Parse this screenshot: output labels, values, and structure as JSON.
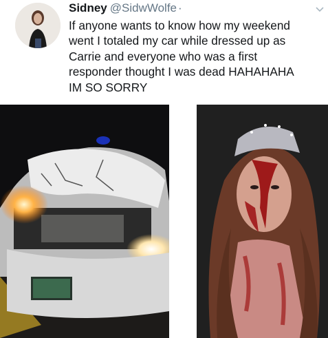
{
  "tweet": {
    "display_name": "Sidney",
    "handle": "@SidwWolfe",
    "separator": "·",
    "text": "If anyone wants to know how my weekend\nwent I totaled my car while dressed up as\nCarrie and everyone who was a first\nresponder thought I was dead HAHAHAHA\nIM SO SORRY"
  },
  "icons": {
    "avatar": "profile-photo",
    "menu": "chevron-down-icon"
  },
  "media": {
    "left": "photo-wrecked-car",
    "right": "photo-carrie-costume"
  },
  "colors": {
    "text": "#14171a",
    "secondary": "#657786",
    "blood": "#9e1a1a"
  }
}
